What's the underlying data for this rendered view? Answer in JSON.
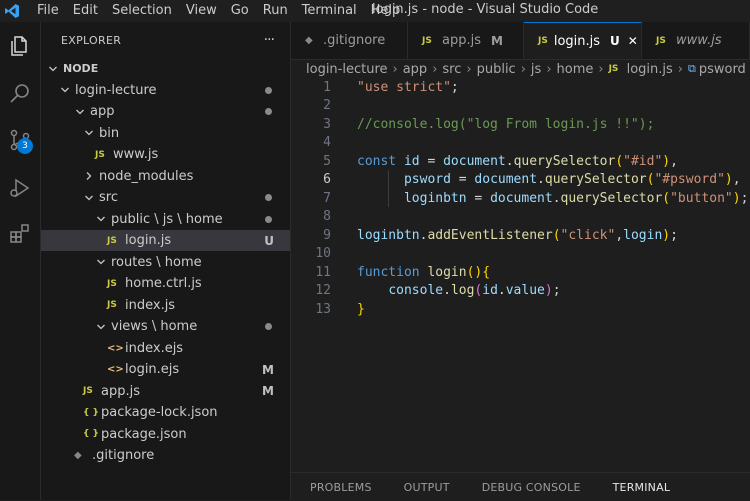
{
  "title": "login.js - node - Visual Studio Code",
  "menu": [
    "File",
    "Edit",
    "Selection",
    "View",
    "Go",
    "Run",
    "Terminal",
    "Help"
  ],
  "activity": {
    "scm_badge": "3"
  },
  "sidebar": {
    "header": "EXPLORER",
    "more": "···",
    "tree": [
      {
        "label": "NODE",
        "kind": "root",
        "depth": 0,
        "open": true
      },
      {
        "label": "login-lecture",
        "kind": "folder",
        "depth": 1,
        "open": true,
        "dot": true
      },
      {
        "label": "app",
        "kind": "folder",
        "depth": 2,
        "open": true,
        "dot": true
      },
      {
        "label": "bin",
        "kind": "folder",
        "depth": 3,
        "open": true
      },
      {
        "label": "www.js",
        "kind": "js",
        "depth": 4
      },
      {
        "label": "node_modules",
        "kind": "folder",
        "depth": 3,
        "open": false
      },
      {
        "label": "src",
        "kind": "folder",
        "depth": 3,
        "open": true,
        "dot": true
      },
      {
        "label": "public \\ js \\ home",
        "kind": "folder",
        "depth": 4,
        "open": true,
        "dot": true
      },
      {
        "label": "login.js",
        "kind": "js",
        "depth": 5,
        "status": "U",
        "selected": true
      },
      {
        "label": "routes \\ home",
        "kind": "folder",
        "depth": 4,
        "open": true
      },
      {
        "label": "home.ctrl.js",
        "kind": "js",
        "depth": 5
      },
      {
        "label": "index.js",
        "kind": "js",
        "depth": 5
      },
      {
        "label": "views \\ home",
        "kind": "folder",
        "depth": 4,
        "open": true,
        "dot": true
      },
      {
        "label": "index.ejs",
        "kind": "ejs",
        "depth": 5
      },
      {
        "label": "login.ejs",
        "kind": "ejs",
        "depth": 5,
        "status": "M"
      },
      {
        "label": "app.js",
        "kind": "js",
        "depth": 3,
        "status": "M"
      },
      {
        "label": "package-lock.json",
        "kind": "json",
        "depth": 3
      },
      {
        "label": "package.json",
        "kind": "json",
        "depth": 3
      },
      {
        "label": ".gitignore",
        "kind": "git",
        "depth": 2
      }
    ]
  },
  "tabs": [
    {
      "label": ".gitignore",
      "icon": "git",
      "mark": "",
      "active": false,
      "italic": false
    },
    {
      "label": "app.js",
      "icon": "js",
      "mark": "M",
      "active": false,
      "italic": false
    },
    {
      "label": "login.js",
      "icon": "js",
      "mark": "U",
      "close": "✕",
      "active": true,
      "italic": false
    },
    {
      "label": "www.js",
      "icon": "js",
      "mark": "",
      "active": false,
      "italic": true
    }
  ],
  "breadcrumb": [
    "login-lecture",
    "app",
    "src",
    "public",
    "js",
    "home",
    "login.js",
    "psword"
  ],
  "editor": {
    "active_line": 6,
    "lines": [
      [
        [
          "t-str",
          "\"use strict\""
        ],
        [
          "t-pun",
          ";"
        ]
      ],
      [],
      [
        [
          "t-cmt",
          "//console.log(\"log From login.js !!\");"
        ]
      ],
      [],
      [
        [
          "t-kw",
          "const "
        ],
        [
          "t-var",
          "id"
        ],
        [
          "t-pun",
          " = "
        ],
        [
          "t-var",
          "document"
        ],
        [
          "t-pun",
          "."
        ],
        [
          "t-fn",
          "querySelector"
        ],
        [
          "t-br",
          "("
        ],
        [
          "t-str",
          "\"#id\""
        ],
        [
          "t-br",
          ")"
        ],
        [
          "t-pun",
          ","
        ]
      ],
      [
        [
          "t-plain",
          "      "
        ],
        [
          "t-var",
          "psword"
        ],
        [
          "t-pun",
          " = "
        ],
        [
          "t-var",
          "document"
        ],
        [
          "t-pun",
          "."
        ],
        [
          "t-fn",
          "querySelector"
        ],
        [
          "t-br",
          "("
        ],
        [
          "t-str",
          "\"#psword\""
        ],
        [
          "t-br",
          ")"
        ],
        [
          "t-pun",
          ","
        ]
      ],
      [
        [
          "t-plain",
          "      "
        ],
        [
          "t-var",
          "loginbtn"
        ],
        [
          "t-pun",
          " = "
        ],
        [
          "t-var",
          "document"
        ],
        [
          "t-pun",
          "."
        ],
        [
          "t-fn",
          "querySelector"
        ],
        [
          "t-br",
          "("
        ],
        [
          "t-str",
          "\"button\""
        ],
        [
          "t-br",
          ")"
        ],
        [
          "t-pun",
          ";"
        ]
      ],
      [],
      [
        [
          "t-var",
          "loginbtn"
        ],
        [
          "t-pun",
          "."
        ],
        [
          "t-fn",
          "addEventListener"
        ],
        [
          "t-br",
          "("
        ],
        [
          "t-str",
          "\"click\""
        ],
        [
          "t-pun",
          ","
        ],
        [
          "t-var",
          "login"
        ],
        [
          "t-br",
          ")"
        ],
        [
          "t-pun",
          ";"
        ]
      ],
      [],
      [
        [
          "t-kw",
          "function "
        ],
        [
          "t-fn",
          "login"
        ],
        [
          "t-br",
          "()"
        ],
        [
          "t-br",
          "{"
        ]
      ],
      [
        [
          "t-plain",
          "    "
        ],
        [
          "t-var",
          "console"
        ],
        [
          "t-pun",
          "."
        ],
        [
          "t-fn",
          "log"
        ],
        [
          "t-br2",
          "("
        ],
        [
          "t-var",
          "id"
        ],
        [
          "t-pun",
          "."
        ],
        [
          "t-var",
          "value"
        ],
        [
          "t-br2",
          ")"
        ],
        [
          "t-pun",
          ";"
        ]
      ],
      [
        [
          "t-br",
          "}"
        ]
      ]
    ]
  },
  "panel_tabs": [
    {
      "label": "PROBLEMS",
      "active": false
    },
    {
      "label": "OUTPUT",
      "active": false
    },
    {
      "label": "DEBUG CONSOLE",
      "active": false
    },
    {
      "label": "TERMINAL",
      "active": true
    }
  ],
  "colors": {
    "accent": "#0078d4",
    "js_icon": "#cbcb41",
    "string": "#ce9178",
    "comment": "#6a9955",
    "keyword": "#569cd6"
  }
}
